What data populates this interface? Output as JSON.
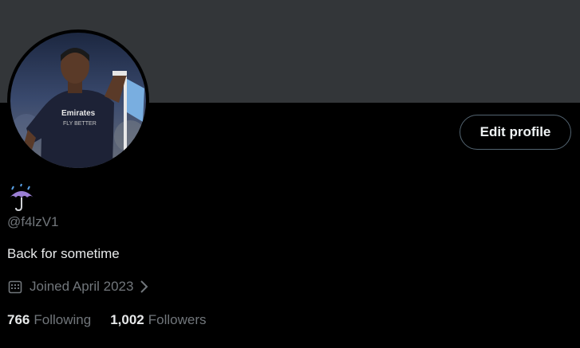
{
  "profile": {
    "display_name_icon": "umbrella-with-rain-emoji",
    "handle": "@f4lzV1",
    "bio": "Back for sometime",
    "joined": "Joined April 2023",
    "edit_button_label": "Edit profile"
  },
  "stats": {
    "following_count": "766",
    "following_label": "Following",
    "followers_count": "1,002",
    "followers_label": "Followers"
  },
  "colors": {
    "background": "#000000",
    "banner": "#333639",
    "primary_text": "#e7e9ea",
    "secondary_text": "#71767b",
    "button_border": "#536471"
  }
}
